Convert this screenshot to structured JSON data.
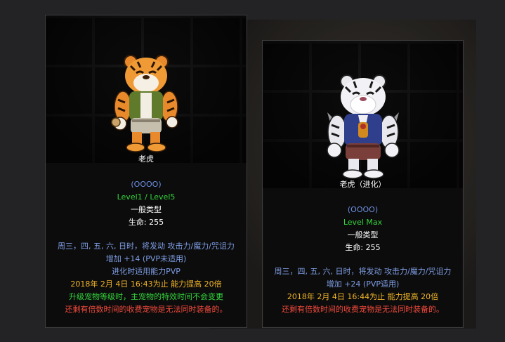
{
  "colors": {
    "name": "#ffffff",
    "slots": "#6d8fe0",
    "level": "#33d33c",
    "effect": "#7f9ee6",
    "expiry": "#f0b428",
    "upgrade_note": "#33d33c",
    "warning": "#f24a3c"
  },
  "cards": [
    {
      "sprite_icon": "orange-tiger-pet-icon",
      "name": "老虎",
      "slots": "(OOOO)",
      "level": "Level1 / Level5",
      "type": "一般类型",
      "hp": "生命: 255",
      "effect_line1": "周三，四, 五, 六, 日时，将发动 攻击力/魔力/咒诅力",
      "effect_line2": "增加 +14 (PVP未适用)",
      "effect_line3": "进化时适用能力PVP",
      "expiry": "2018年 2月 4日 16:43为止 能力提高 20倍",
      "upgrade_note": "升级宠物等级时，主宠物的特效时间不会变更",
      "warning": "还剩有倍数时间的收费宠物是无法同时装备的。"
    },
    {
      "sprite_icon": "white-tiger-pet-icon",
      "name": "老虎（进化）",
      "slots": "(OOOO)",
      "level": "Level Max",
      "type": "一般类型",
      "hp": "生命: 255",
      "effect_line1": "周三，四, 五, 六, 日时，将发动 攻击力/魔力/咒诅力",
      "effect_line2": "增加 +24 (PVP适用)",
      "expiry": "2018年 2月 4日 16:44为止 能力提高 20倍",
      "warning": "还剩有倍数时间的收费宠物是无法同时装备的。"
    }
  ]
}
